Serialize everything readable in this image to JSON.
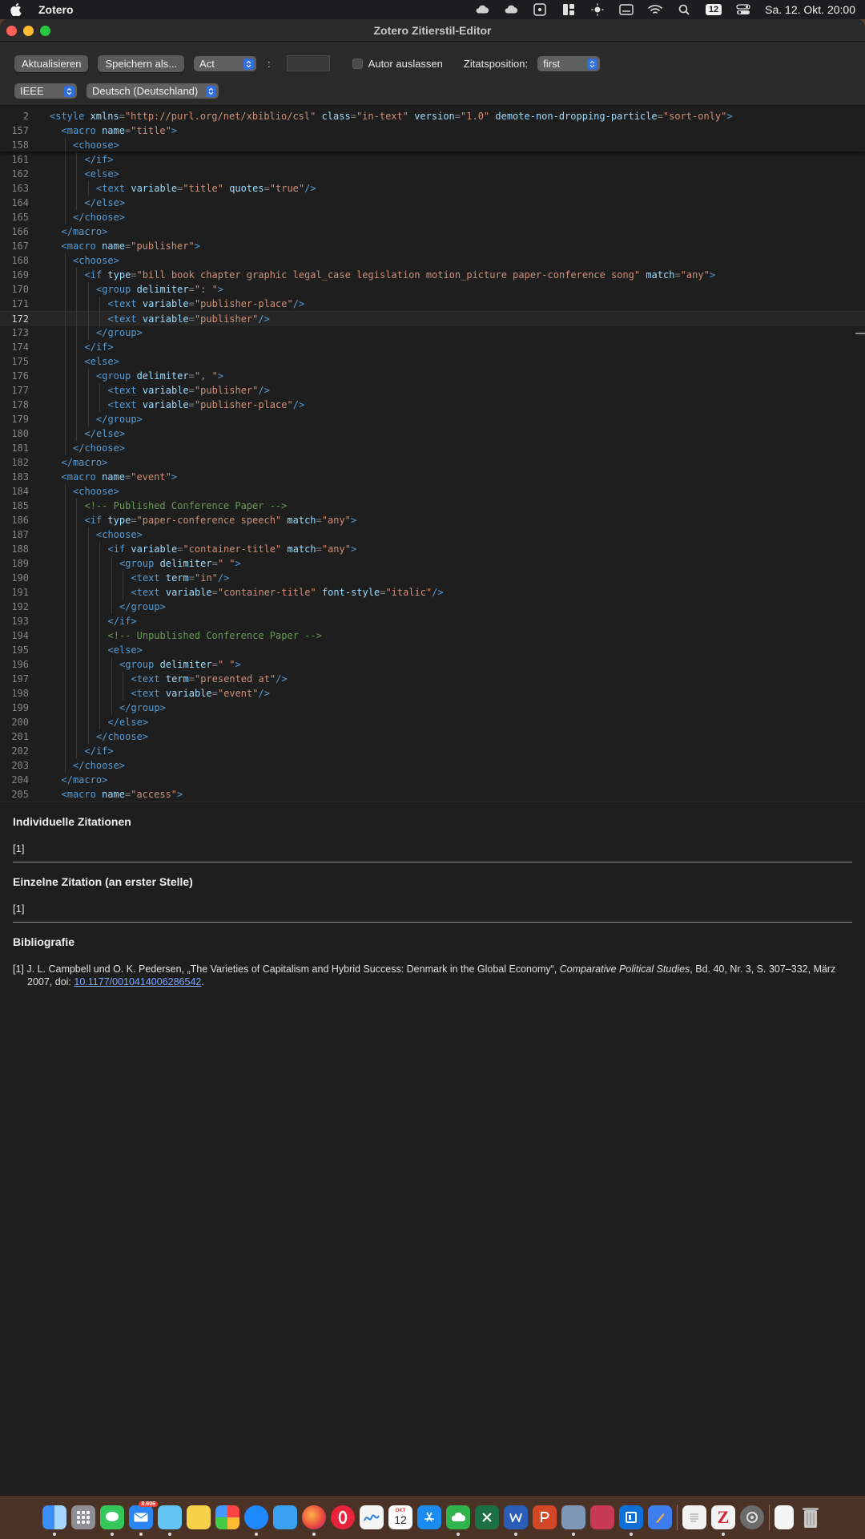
{
  "menubar": {
    "app_name": "Zotero",
    "calendar_badge": "12",
    "clock": "Sa. 12. Okt. 20:00"
  },
  "window": {
    "title": "Zotero Zitierstil-Editor"
  },
  "toolbar": {
    "refresh_label": "Aktualisieren",
    "save_as_label": "Speichern als...",
    "locator_select": "Act",
    "locator_separator": ":",
    "locator_value": "",
    "suppress_author_label": "Autor auslassen",
    "position_label": "Zitatsposition:",
    "position_select": "first",
    "style_select": "IEEE",
    "locale_select": "Deutsch (Deutschland)"
  },
  "editor": {
    "lines": [
      {
        "n": "2",
        "indent": 0,
        "tokens": [
          [
            "tag",
            "<style "
          ],
          [
            "attr",
            "xmlns"
          ],
          [
            "punc",
            "="
          ],
          [
            "val",
            "\"http://purl.org/net/xbiblio/csl\""
          ],
          [
            "attr",
            " class"
          ],
          [
            "punc",
            "="
          ],
          [
            "val",
            "\"in-text\""
          ],
          [
            "attr",
            " version"
          ],
          [
            "punc",
            "="
          ],
          [
            "val",
            "\"1.0\""
          ],
          [
            "attr",
            " demote-non-dropping-particle"
          ],
          [
            "punc",
            "="
          ],
          [
            "val",
            "\"sort-only\""
          ],
          [
            "tag",
            ">"
          ]
        ]
      },
      {
        "n": "157",
        "indent": 1,
        "tokens": [
          [
            "tag",
            "<macro "
          ],
          [
            "attr",
            "name"
          ],
          [
            "punc",
            "="
          ],
          [
            "val",
            "\"title\""
          ],
          [
            "tag",
            ">"
          ]
        ]
      },
      {
        "n": "158",
        "indent": 2,
        "tokens": [
          [
            "tag",
            "<choose>"
          ]
        ]
      },
      {
        "n": "161",
        "indent": 3,
        "tokens": [
          [
            "tag",
            "</if>"
          ]
        ]
      },
      {
        "n": "162",
        "indent": 3,
        "tokens": [
          [
            "tag",
            "<else>"
          ]
        ]
      },
      {
        "n": "163",
        "indent": 4,
        "tokens": [
          [
            "tag",
            "<text "
          ],
          [
            "attr",
            "variable"
          ],
          [
            "punc",
            "="
          ],
          [
            "val",
            "\"title\""
          ],
          [
            "attr",
            " quotes"
          ],
          [
            "punc",
            "="
          ],
          [
            "val",
            "\"true\""
          ],
          [
            "tag",
            "/>"
          ]
        ]
      },
      {
        "n": "164",
        "indent": 3,
        "tokens": [
          [
            "tag",
            "</else>"
          ]
        ]
      },
      {
        "n": "165",
        "indent": 2,
        "tokens": [
          [
            "tag",
            "</choose>"
          ]
        ]
      },
      {
        "n": "166",
        "indent": 1,
        "tokens": [
          [
            "tag",
            "</macro>"
          ]
        ]
      },
      {
        "n": "167",
        "indent": 1,
        "tokens": [
          [
            "tag",
            "<macro "
          ],
          [
            "attr",
            "name"
          ],
          [
            "punc",
            "="
          ],
          [
            "val",
            "\"publisher\""
          ],
          [
            "tag",
            ">"
          ]
        ]
      },
      {
        "n": "168",
        "indent": 2,
        "tokens": [
          [
            "tag",
            "<choose>"
          ]
        ]
      },
      {
        "n": "169",
        "indent": 3,
        "tokens": [
          [
            "tag",
            "<if "
          ],
          [
            "attr",
            "type"
          ],
          [
            "punc",
            "="
          ],
          [
            "val",
            "\"bill book chapter graphic legal_case legislation motion_picture paper-conference song\""
          ],
          [
            "attr",
            " match"
          ],
          [
            "punc",
            "="
          ],
          [
            "val",
            "\"any\""
          ],
          [
            "tag",
            ">"
          ]
        ]
      },
      {
        "n": "170",
        "indent": 4,
        "tokens": [
          [
            "tag",
            "<group "
          ],
          [
            "attr",
            "delimiter"
          ],
          [
            "punc",
            "="
          ],
          [
            "val",
            "\": \""
          ],
          [
            "tag",
            ">"
          ]
        ]
      },
      {
        "n": "171",
        "indent": 5,
        "tokens": [
          [
            "tag",
            "<text "
          ],
          [
            "attr",
            "variable"
          ],
          [
            "punc",
            "="
          ],
          [
            "val",
            "\"publisher-place\""
          ],
          [
            "tag",
            "/>"
          ]
        ]
      },
      {
        "n": "172",
        "indent": 5,
        "cur": true,
        "tokens": [
          [
            "tag",
            "<text "
          ],
          [
            "attr",
            "variable"
          ],
          [
            "punc",
            "="
          ],
          [
            "val",
            "\"publisher\""
          ],
          [
            "tag",
            "/>"
          ]
        ]
      },
      {
        "n": "173",
        "indent": 4,
        "tokens": [
          [
            "tag",
            "</group>"
          ]
        ]
      },
      {
        "n": "174",
        "indent": 3,
        "tokens": [
          [
            "tag",
            "</if>"
          ]
        ]
      },
      {
        "n": "175",
        "indent": 3,
        "tokens": [
          [
            "tag",
            "<else>"
          ]
        ]
      },
      {
        "n": "176",
        "indent": 4,
        "tokens": [
          [
            "tag",
            "<group "
          ],
          [
            "attr",
            "delimiter"
          ],
          [
            "punc",
            "="
          ],
          [
            "val",
            "\", \""
          ],
          [
            "tag",
            ">"
          ]
        ]
      },
      {
        "n": "177",
        "indent": 5,
        "tokens": [
          [
            "tag",
            "<text "
          ],
          [
            "attr",
            "variable"
          ],
          [
            "punc",
            "="
          ],
          [
            "val",
            "\"publisher\""
          ],
          [
            "tag",
            "/>"
          ]
        ]
      },
      {
        "n": "178",
        "indent": 5,
        "tokens": [
          [
            "tag",
            "<text "
          ],
          [
            "attr",
            "variable"
          ],
          [
            "punc",
            "="
          ],
          [
            "val",
            "\"publisher-place\""
          ],
          [
            "tag",
            "/>"
          ]
        ]
      },
      {
        "n": "179",
        "indent": 4,
        "tokens": [
          [
            "tag",
            "</group>"
          ]
        ]
      },
      {
        "n": "180",
        "indent": 3,
        "tokens": [
          [
            "tag",
            "</else>"
          ]
        ]
      },
      {
        "n": "181",
        "indent": 2,
        "tokens": [
          [
            "tag",
            "</choose>"
          ]
        ]
      },
      {
        "n": "182",
        "indent": 1,
        "tokens": [
          [
            "tag",
            "</macro>"
          ]
        ]
      },
      {
        "n": "183",
        "indent": 1,
        "tokens": [
          [
            "tag",
            "<macro "
          ],
          [
            "attr",
            "name"
          ],
          [
            "punc",
            "="
          ],
          [
            "val",
            "\"event\""
          ],
          [
            "tag",
            ">"
          ]
        ]
      },
      {
        "n": "184",
        "indent": 2,
        "tokens": [
          [
            "tag",
            "<choose>"
          ]
        ]
      },
      {
        "n": "185",
        "indent": 3,
        "tokens": [
          [
            "comment",
            "<!-- Published Conference Paper -->"
          ]
        ]
      },
      {
        "n": "186",
        "indent": 3,
        "tokens": [
          [
            "tag",
            "<if "
          ],
          [
            "attr",
            "type"
          ],
          [
            "punc",
            "="
          ],
          [
            "val",
            "\"paper-conference speech\""
          ],
          [
            "attr",
            " match"
          ],
          [
            "punc",
            "="
          ],
          [
            "val",
            "\"any\""
          ],
          [
            "tag",
            ">"
          ]
        ]
      },
      {
        "n": "187",
        "indent": 4,
        "tokens": [
          [
            "tag",
            "<choose>"
          ]
        ]
      },
      {
        "n": "188",
        "indent": 5,
        "tokens": [
          [
            "tag",
            "<if "
          ],
          [
            "attr",
            "variable"
          ],
          [
            "punc",
            "="
          ],
          [
            "val",
            "\"container-title\""
          ],
          [
            "attr",
            " match"
          ],
          [
            "punc",
            "="
          ],
          [
            "val",
            "\"any\""
          ],
          [
            "tag",
            ">"
          ]
        ]
      },
      {
        "n": "189",
        "indent": 6,
        "tokens": [
          [
            "tag",
            "<group "
          ],
          [
            "attr",
            "delimiter"
          ],
          [
            "punc",
            "="
          ],
          [
            "val",
            "\" \""
          ],
          [
            "tag",
            ">"
          ]
        ]
      },
      {
        "n": "190",
        "indent": 7,
        "tokens": [
          [
            "tag",
            "<text "
          ],
          [
            "attr",
            "term"
          ],
          [
            "punc",
            "="
          ],
          [
            "val",
            "\"in\""
          ],
          [
            "tag",
            "/>"
          ]
        ]
      },
      {
        "n": "191",
        "indent": 7,
        "tokens": [
          [
            "tag",
            "<text "
          ],
          [
            "attr",
            "variable"
          ],
          [
            "punc",
            "="
          ],
          [
            "val",
            "\"container-title\""
          ],
          [
            "attr",
            " font-style"
          ],
          [
            "punc",
            "="
          ],
          [
            "val",
            "\"italic\""
          ],
          [
            "tag",
            "/>"
          ]
        ]
      },
      {
        "n": "192",
        "indent": 6,
        "tokens": [
          [
            "tag",
            "</group>"
          ]
        ]
      },
      {
        "n": "193",
        "indent": 5,
        "tokens": [
          [
            "tag",
            "</if>"
          ]
        ]
      },
      {
        "n": "194",
        "indent": 5,
        "tokens": [
          [
            "comment",
            "<!-- Unpublished Conference Paper -->"
          ]
        ]
      },
      {
        "n": "195",
        "indent": 5,
        "tokens": [
          [
            "tag",
            "<else>"
          ]
        ]
      },
      {
        "n": "196",
        "indent": 6,
        "tokens": [
          [
            "tag",
            "<group "
          ],
          [
            "attr",
            "delimiter"
          ],
          [
            "punc",
            "="
          ],
          [
            "val",
            "\" \""
          ],
          [
            "tag",
            ">"
          ]
        ]
      },
      {
        "n": "197",
        "indent": 7,
        "tokens": [
          [
            "tag",
            "<text "
          ],
          [
            "attr",
            "term"
          ],
          [
            "punc",
            "="
          ],
          [
            "val",
            "\"presented at\""
          ],
          [
            "tag",
            "/>"
          ]
        ]
      },
      {
        "n": "198",
        "indent": 7,
        "tokens": [
          [
            "tag",
            "<text "
          ],
          [
            "attr",
            "variable"
          ],
          [
            "punc",
            "="
          ],
          [
            "val",
            "\"event\""
          ],
          [
            "tag",
            "/>"
          ]
        ]
      },
      {
        "n": "199",
        "indent": 6,
        "tokens": [
          [
            "tag",
            "</group>"
          ]
        ]
      },
      {
        "n": "200",
        "indent": 5,
        "tokens": [
          [
            "tag",
            "</else>"
          ]
        ]
      },
      {
        "n": "201",
        "indent": 4,
        "tokens": [
          [
            "tag",
            "</choose>"
          ]
        ]
      },
      {
        "n": "202",
        "indent": 3,
        "tokens": [
          [
            "tag",
            "</if>"
          ]
        ]
      },
      {
        "n": "203",
        "indent": 2,
        "tokens": [
          [
            "tag",
            "</choose>"
          ]
        ]
      },
      {
        "n": "204",
        "indent": 1,
        "tokens": [
          [
            "tag",
            "</macro>"
          ]
        ]
      },
      {
        "n": "205",
        "indent": 1,
        "tokens": [
          [
            "tag",
            "<macro "
          ],
          [
            "attr",
            "name"
          ],
          [
            "punc",
            "="
          ],
          [
            "val",
            "\"access\""
          ],
          [
            "tag",
            ">"
          ]
        ]
      }
    ]
  },
  "preview": {
    "individual_heading": "Individuelle Zitationen",
    "individual_value": "[1]",
    "single_heading": "Einzelne Zitation (an erster Stelle)",
    "single_value": "[1]",
    "bibliography_heading": "Bibliografie",
    "bib_entry": {
      "prefix": "[1] J. L. Campbell und O. K. Pedersen, „The Varieties of Capitalism and Hybrid Success: Denmark in the Global Economy“, ",
      "journal": "Comparative Political Studies",
      "middle": ", Bd. 40, Nr. 3, S. 307–332, März 2007, doi: ",
      "doi": "10.1177/0010414006286542",
      "suffix": "."
    }
  },
  "dock": {
    "mail_badge": "8.606",
    "calendar_month": "OKT",
    "calendar_day": "12",
    "apps": [
      "finder",
      "launchpad",
      "messages",
      "mail",
      "maps",
      "notes",
      "photos",
      "safari",
      "files",
      "firefox",
      "opera",
      "freeform",
      "calendar",
      "app-store",
      "cloud-app",
      "excel",
      "word",
      "powerpoint",
      "preview",
      "acrobat",
      "planner",
      "pages",
      "textedit",
      "zotero",
      "disk-utility",
      "document",
      "trash"
    ]
  }
}
